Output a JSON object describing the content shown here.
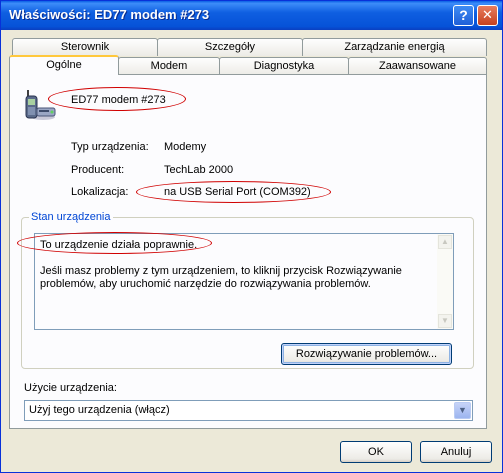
{
  "window": {
    "title": "Właściwości: ED77 modem #273",
    "help_glyph": "?",
    "close_glyph": "✕"
  },
  "tabs_back": [
    "Sterownik",
    "Szczegóły",
    "Zarządzanie energią"
  ],
  "tabs_front": [
    "Ogólne",
    "Modem",
    "Diagnostyka",
    "Zaawansowane"
  ],
  "device": {
    "name": "ED77 modem #273",
    "props": [
      {
        "label": "Typ urządzenia:",
        "value": "Modemy"
      },
      {
        "label": "Producent:",
        "value": "TechLab 2000"
      },
      {
        "label": "Lokalizacja:",
        "value": "na USB Serial Port (COM392)"
      }
    ]
  },
  "status": {
    "group_title": "Stan urządzenia",
    "line1": "To urządzenie działa poprawnie.",
    "line2": "Jeśli masz problemy z tym urządzeniem, to kliknij przycisk Rozwiązywanie",
    "line3": "problemów, aby uruchomić narzędzie do rozwiązywania problemów.",
    "troubleshoot_button": "Rozwiązywanie problemów..."
  },
  "usage": {
    "label": "Użycie urządzenia:",
    "selected": "Użyj tego urządzenia (włącz)"
  },
  "buttons": {
    "ok": "OK",
    "cancel": "Anuluj"
  }
}
